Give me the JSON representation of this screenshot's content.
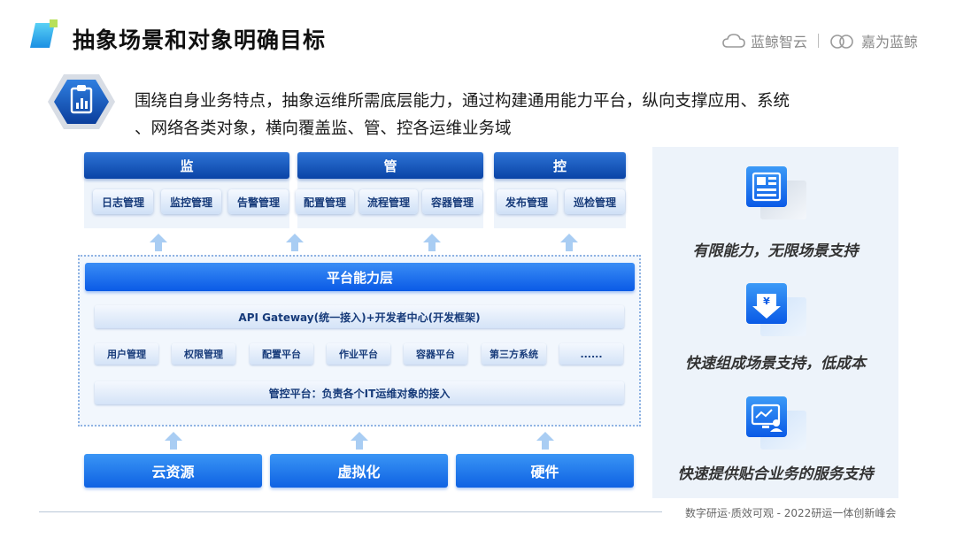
{
  "header": {
    "title": "抽象场景和对象明确目标",
    "brand_left": "蓝鲸智云",
    "brand_right": "嘉为蓝鲸"
  },
  "intro": {
    "line1": "围绕自身业务特点，抽象运维所需底层能力，通过构建通用能力平台，纵向支撑应用、系统",
    "line2": "、网络各类对象，横向覆盖监、管、控各运维业务域",
    "icon": "clipboard-chart-icon"
  },
  "categories": [
    {
      "label": "监",
      "items": [
        "日志管理",
        "监控管理",
        "告警管理"
      ]
    },
    {
      "label": "管",
      "items": [
        "配置管理",
        "流程管理",
        "容器管理"
      ]
    },
    {
      "label": "控",
      "items": [
        "发布管理",
        "巡检管理"
      ]
    }
  ],
  "platform": {
    "title": "平台能力层",
    "gateway": "API Gateway(统一接入)+开发者中心(开发框架)",
    "modules": [
      "用户管理",
      "权限管理",
      "配置平台",
      "作业平台",
      "容器平台",
      "第三方系统",
      "......"
    ],
    "control": "管控平台：负责各个IT运维对象的接入"
  },
  "infrastructure": [
    "云资源",
    "虚拟化",
    "硬件"
  ],
  "features": [
    {
      "icon": "dashboard-window-icon",
      "text": "有限能力，无限场景支持"
    },
    {
      "icon": "yen-download-icon",
      "text": "快速组成场景支持，低成本"
    },
    {
      "icon": "monitor-user-icon",
      "text": "快速提供贴合业务的服务支持"
    }
  ],
  "footer": {
    "text": "数字研运·质效可观  -  2022研运一体创新峰会"
  },
  "colors": {
    "accent_dark": "#0a43a6",
    "accent_bright": "#0a5ae6",
    "panel_bg": "#edf3fa"
  }
}
